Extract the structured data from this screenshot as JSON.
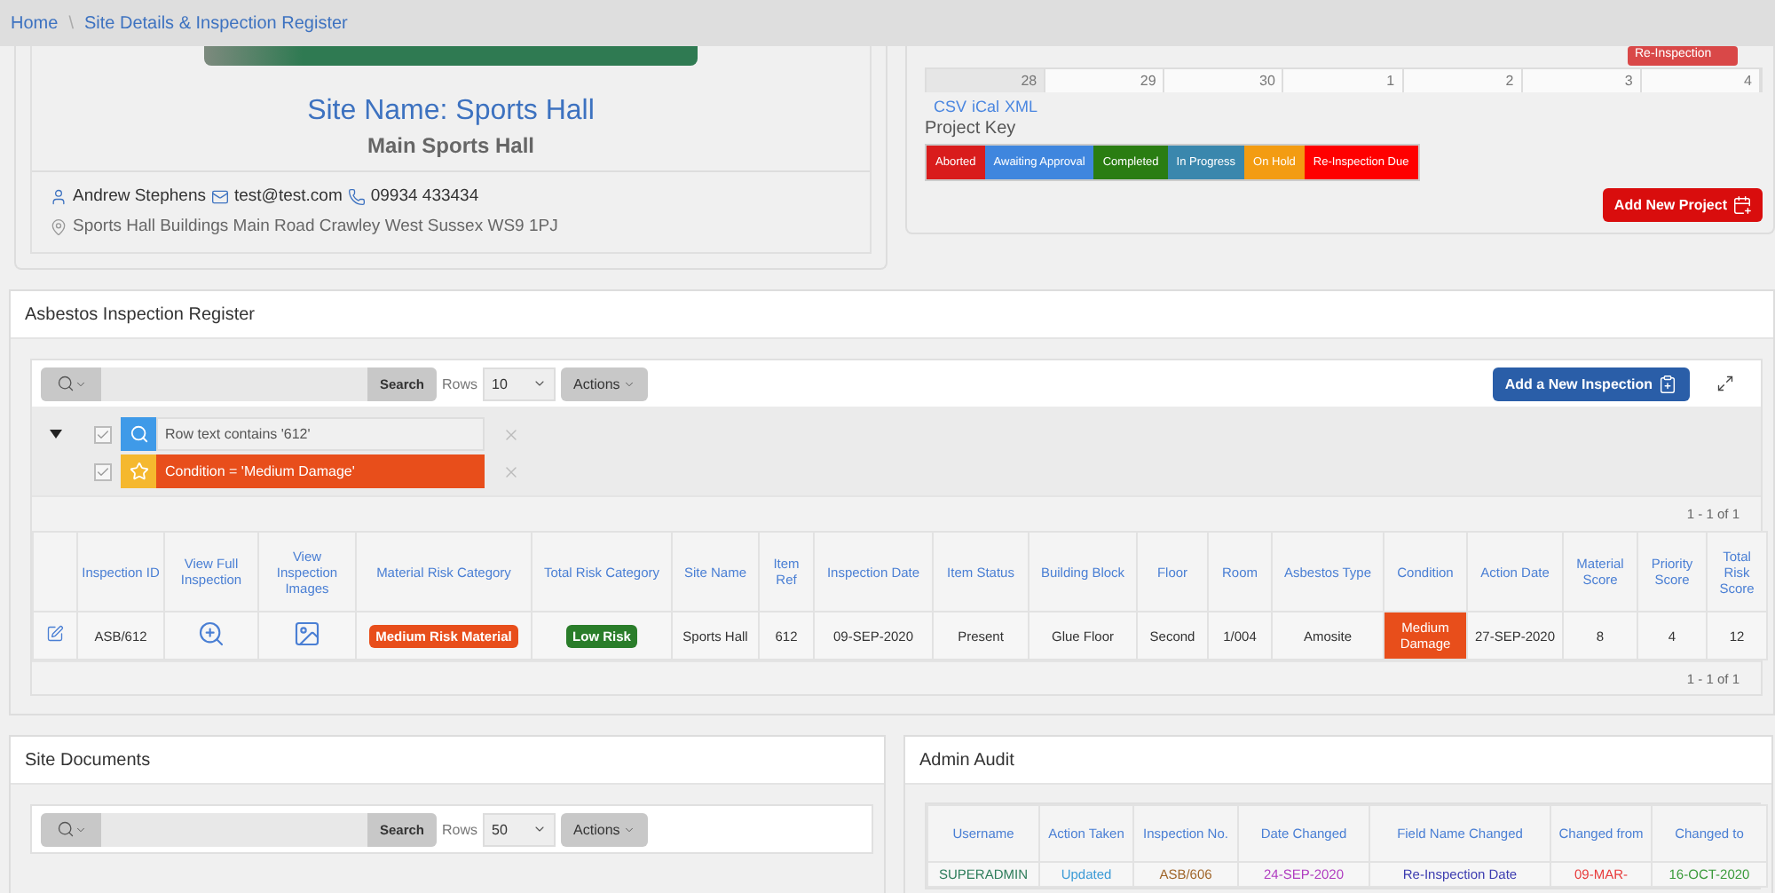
{
  "breadcrumb": [
    {
      "label": "Home"
    },
    {
      "label": "Site Details & Inspection Register"
    }
  ],
  "breadcrumb_separator": "\\",
  "site": {
    "title": "Site Name: Sports Hall",
    "subtitle": "Main Sports Hall",
    "contact": "Andrew Stephens",
    "email": "test@test.com",
    "phone": "09934 433434",
    "address": "Sports Hall Buildings Main Road Crawley West Sussex WS9 1PJ"
  },
  "calendar": {
    "event": "Re-Inspection",
    "days": [
      "28",
      "29",
      "30",
      "1",
      "2",
      "3",
      "4"
    ],
    "exports": [
      "CSV",
      "iCal",
      "XML"
    ]
  },
  "project_key": {
    "title": "Project Key",
    "items": [
      {
        "label": "Aborted",
        "color": "#d91c1c"
      },
      {
        "label": "Awaiting Approval",
        "color": "#3f86de"
      },
      {
        "label": "Completed",
        "color": "#2a7d12"
      },
      {
        "label": "In Progress",
        "color": "#3a87ad"
      },
      {
        "label": "On Hold",
        "color": "#f39c12"
      },
      {
        "label": "Re-Inspection Due",
        "color": "#ff0000"
      }
    ]
  },
  "add_project_button": "Add New Project",
  "inspection_register": {
    "title": "Asbestos Inspection Register",
    "search_button": "Search",
    "rows_label": "Rows",
    "rows_value": "10",
    "actions": "Actions",
    "add_button": "Add a New Inspection",
    "filters": [
      {
        "kind": "search",
        "text": "Row text contains '612'",
        "checked": true
      },
      {
        "kind": "highlight",
        "text": "Condition = 'Medium Damage'",
        "checked": true
      }
    ],
    "pagination_top": "1 - 1 of 1",
    "columns": [
      "",
      "Inspection ID",
      "View Full Inspection",
      "View Inspection Images",
      "Material Risk Category",
      "Total Risk Category",
      "Site Name",
      "Item Ref",
      "Inspection Date",
      "Item Status",
      "Building Block",
      "Floor",
      "Room",
      "Asbestos Type",
      "Condition",
      "Action Date",
      "Material Score",
      "Priority Score",
      "Total Risk Score"
    ],
    "rows": [
      [
        {
          "kind": "edit"
        },
        {
          "kind": "text",
          "text": "ASB/612"
        },
        {
          "kind": "zoom"
        },
        {
          "kind": "image"
        },
        {
          "kind": "badge",
          "text": "Medium Risk Material",
          "color": "#e84e1b"
        },
        {
          "kind": "badge",
          "text": "Low Risk",
          "color": "#2a7d2a"
        },
        {
          "kind": "text",
          "text": "Sports Hall"
        },
        {
          "kind": "text",
          "text": "612"
        },
        {
          "kind": "text",
          "text": "09-SEP-2020"
        },
        {
          "kind": "text",
          "text": "Present"
        },
        {
          "kind": "text",
          "text": "Glue Floor"
        },
        {
          "kind": "text",
          "text": "Second"
        },
        {
          "kind": "text",
          "text": "1/004"
        },
        {
          "kind": "text",
          "text": "Amosite"
        },
        {
          "kind": "highlight",
          "text": "Medium Damage",
          "color": "#e84e1b"
        },
        {
          "kind": "text",
          "text": "27-SEP-2020"
        },
        {
          "kind": "text",
          "text": "8"
        },
        {
          "kind": "text",
          "text": "4"
        },
        {
          "kind": "text",
          "text": "12"
        }
      ]
    ],
    "pagination_bottom": "1 - 1 of 1"
  },
  "site_documents": {
    "title": "Site Documents",
    "search_button": "Search",
    "rows_label": "Rows",
    "rows_value": "50",
    "actions": "Actions"
  },
  "admin_audit": {
    "title": "Admin Audit",
    "columns": [
      "Username",
      "Action Taken",
      "Inspection No.",
      "Date Changed",
      "Field Name Changed",
      "Changed from",
      "Changed to"
    ],
    "rows": [
      [
        {
          "text": "SUPERADMIN",
          "color": "#2e7d5b"
        },
        {
          "text": "Updated",
          "color": "#3c9bd6"
        },
        {
          "text": "ASB/606",
          "color": "#a0662a"
        },
        {
          "text": "24-SEP-2020",
          "color": "#b03cc0"
        },
        {
          "text": "Re-Inspection Date",
          "color": "#3c3cb0"
        },
        {
          "text": "09-MAR-",
          "color": "#e83c3c"
        },
        {
          "text": "16-OCT-2020",
          "color": "#3a9a3a"
        }
      ]
    ]
  }
}
